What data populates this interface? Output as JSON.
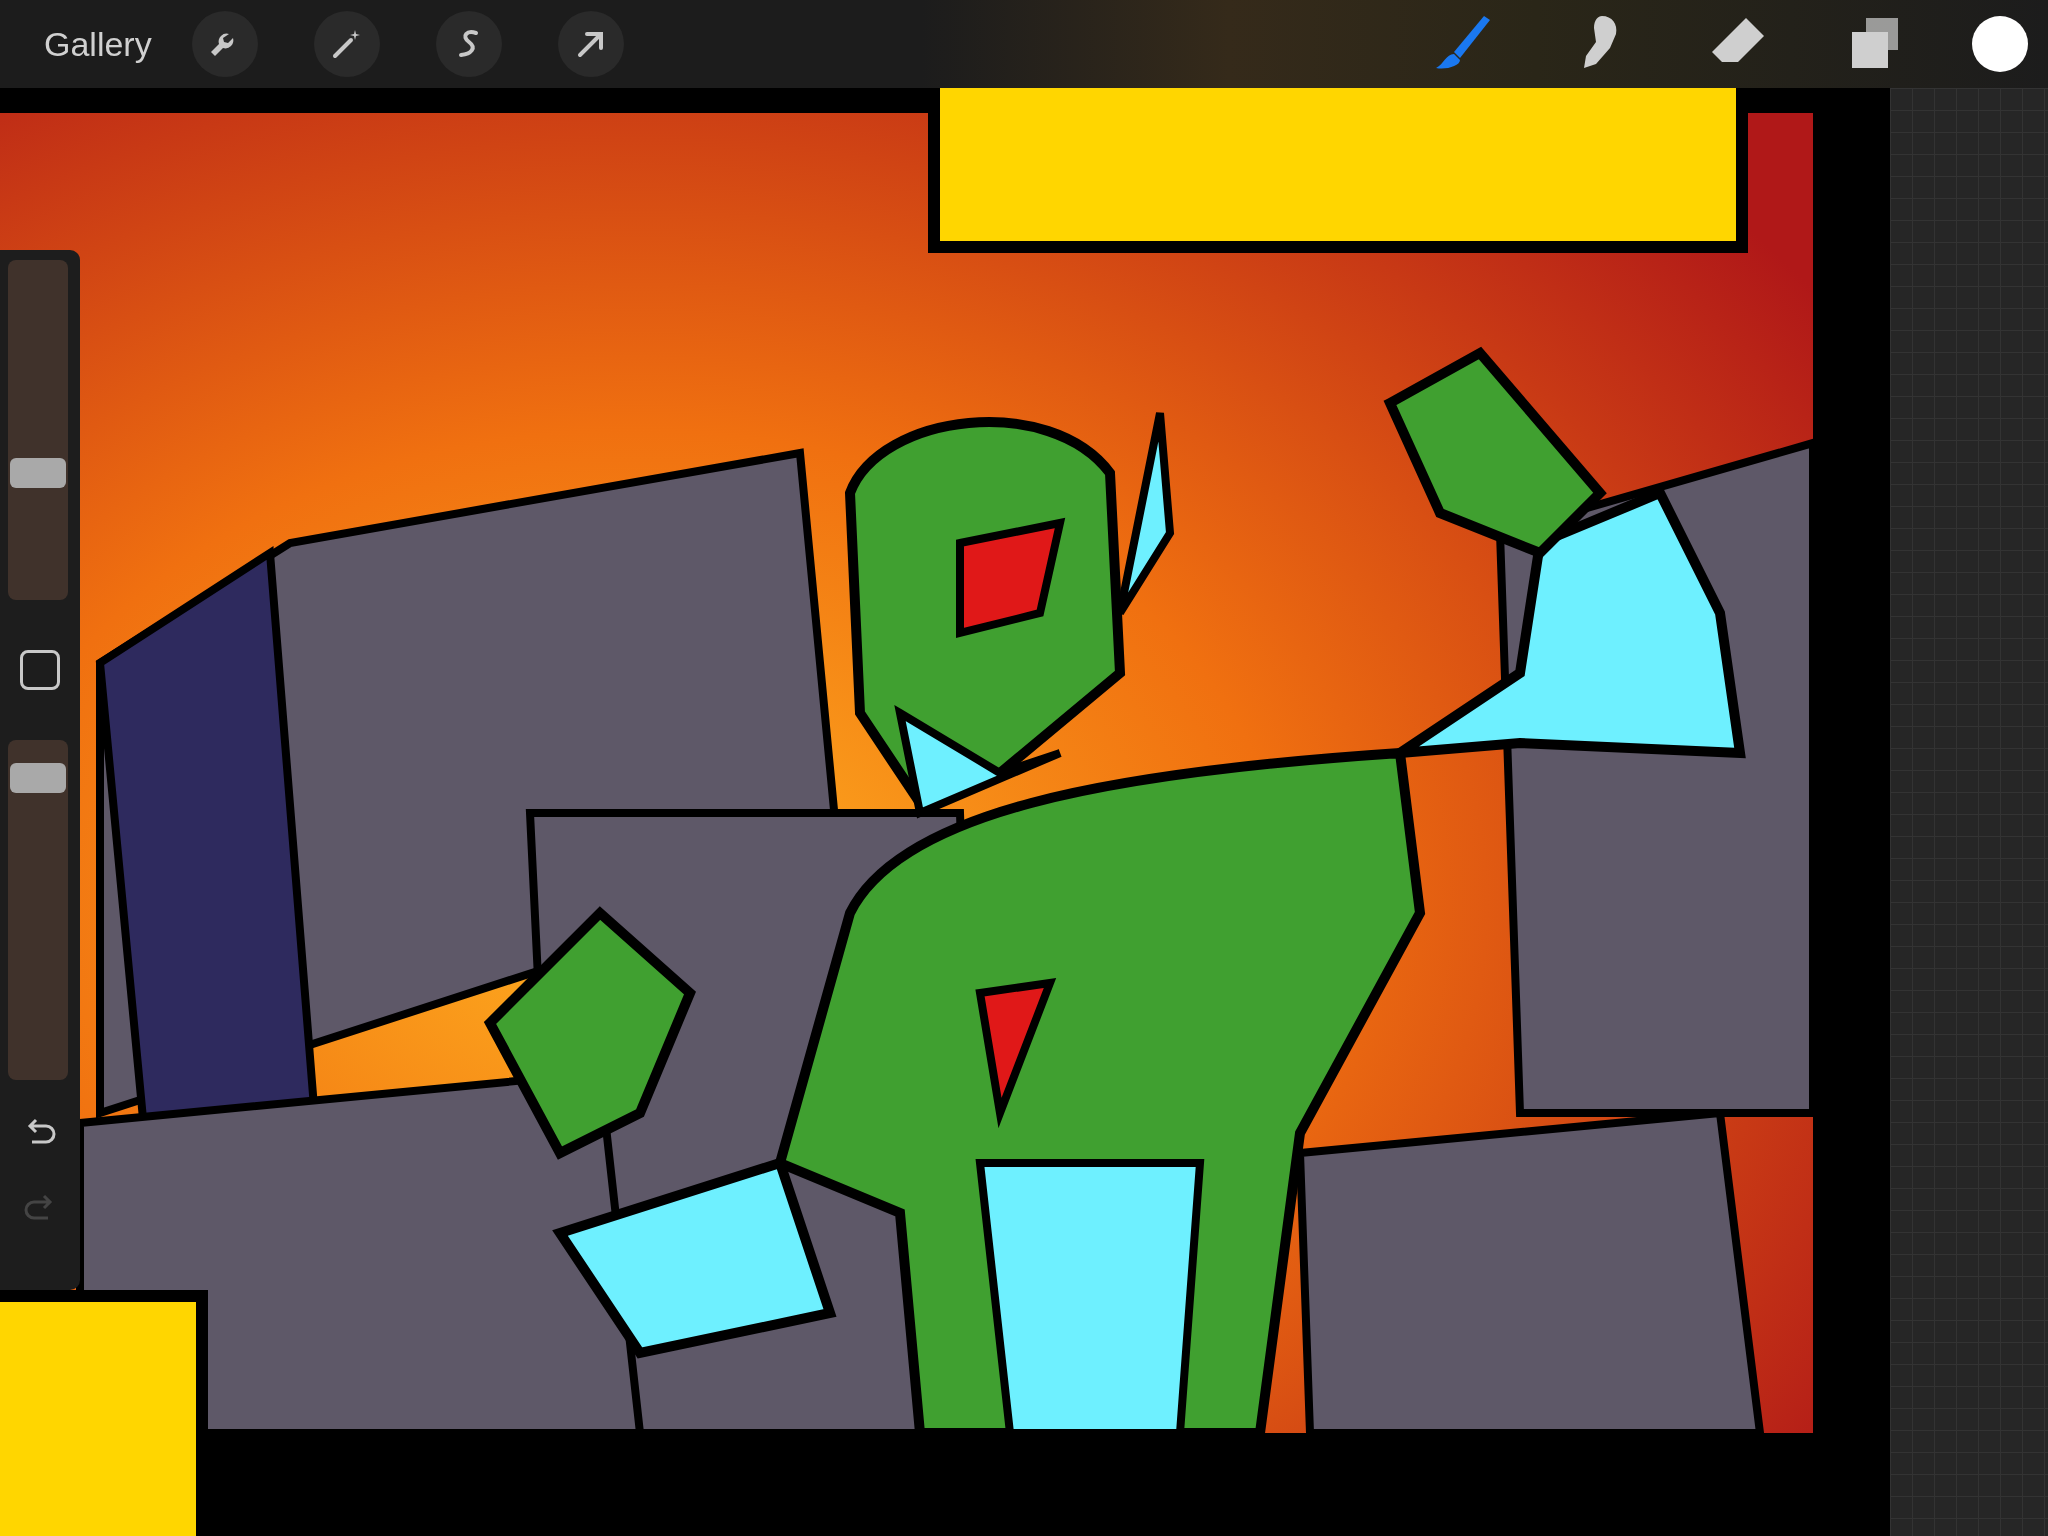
{
  "toolbar": {
    "gallery_label": "Gallery",
    "left_tools": [
      {
        "kind": "wrench"
      },
      {
        "kind": "wand"
      },
      {
        "kind": "selection"
      },
      {
        "kind": "arrow"
      }
    ],
    "right_tools": [
      {
        "kind": "brush",
        "selected": true
      },
      {
        "kind": "smudge",
        "selected": false
      },
      {
        "kind": "eraser",
        "selected": false
      },
      {
        "kind": "layers",
        "selected": false
      }
    ],
    "color_swatch": {
      "color": "#ffffff"
    }
  },
  "sidebar": {
    "size_slider": {
      "level": 0.36
    },
    "opacity_slider": {
      "level": 0.93
    },
    "undo": {
      "disabled": false
    },
    "redo": {
      "disabled": true
    }
  }
}
